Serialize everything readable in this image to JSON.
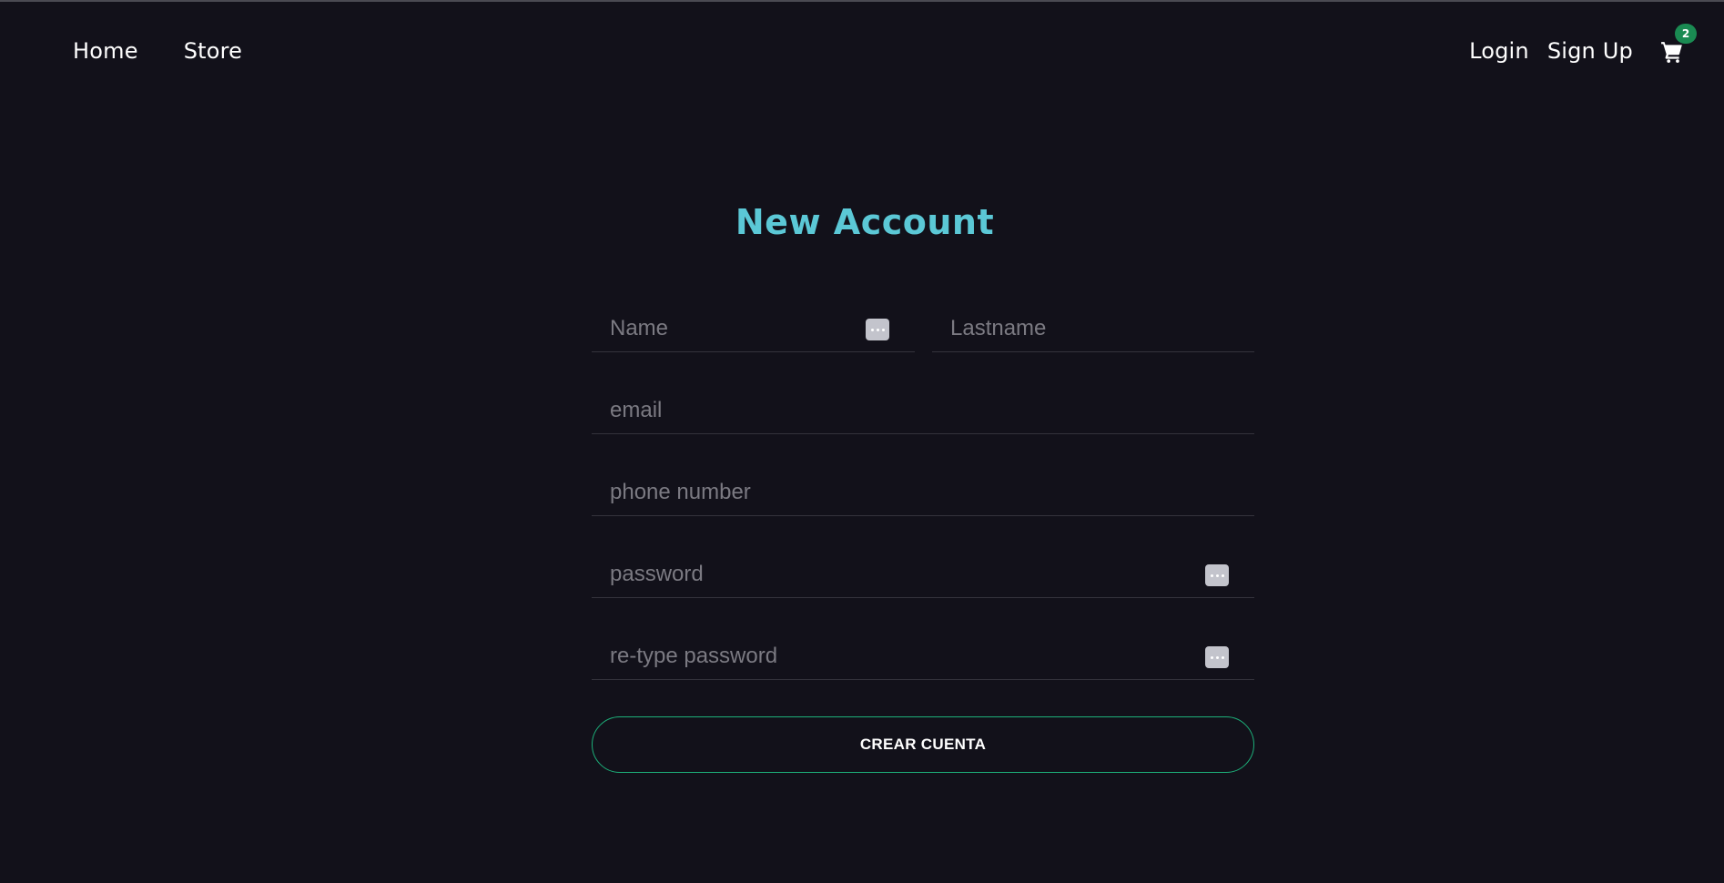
{
  "nav": {
    "home": "Home",
    "store": "Store",
    "login": "Login",
    "signup": "Sign Up",
    "cart_count": "2",
    "cart_icon": "shopping-cart-icon"
  },
  "form": {
    "title": "New Account",
    "name_placeholder": "Name",
    "lastname_placeholder": "Lastname",
    "email_placeholder": "email",
    "phone_placeholder": "phone number",
    "password_placeholder": "password",
    "retype_placeholder": "re-type password",
    "submit_label": "CREAR CUENTA"
  },
  "colors": {
    "background": "#12111a",
    "title": "#5bc8d6",
    "button_border": "#1db07a",
    "badge": "#1a8a52"
  }
}
